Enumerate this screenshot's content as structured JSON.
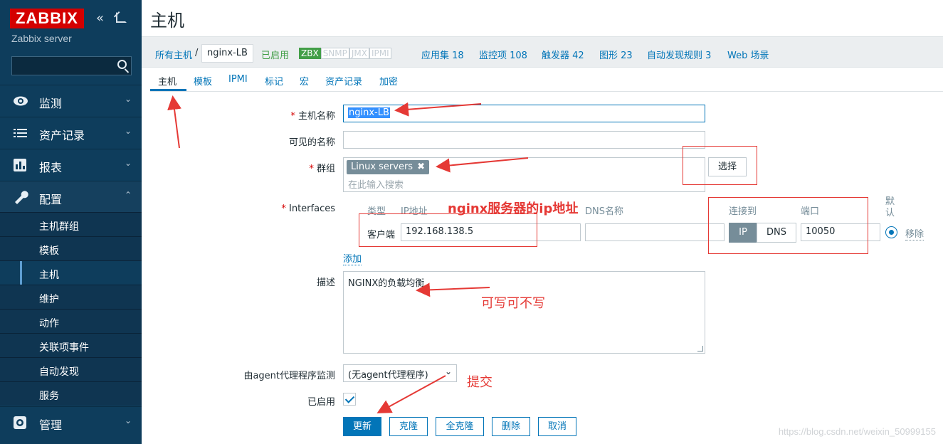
{
  "sidebar": {
    "logo": "ZABBIX",
    "server_name": "Zabbix server",
    "collapse_icon": "«",
    "menu": [
      {
        "label": "监测",
        "icon": "eye-icon"
      },
      {
        "label": "资产记录",
        "icon": "list-icon"
      },
      {
        "label": "报表",
        "icon": "bar-chart-icon"
      },
      {
        "label": "配置",
        "icon": "wrench-icon"
      },
      {
        "label": "管理",
        "icon": "gear-icon"
      }
    ],
    "submenu": [
      "主机群组",
      "模板",
      "主机",
      "维护",
      "动作",
      "关联项事件",
      "自动发现",
      "服务"
    ],
    "active_submenu": "主机"
  },
  "page": {
    "title": "主机"
  },
  "host_nav": {
    "all_hosts": "所有主机",
    "separator": "/",
    "current_host": "nginx-LB",
    "enabled": "已启用",
    "badges": [
      {
        "label": "ZBX",
        "active": true
      },
      {
        "label": "SNMP",
        "active": false
      },
      {
        "label": "JMX",
        "active": false
      },
      {
        "label": "IPMI",
        "active": false
      }
    ],
    "links": {
      "applications": "应用集 18",
      "items": "监控项 108",
      "triggers": "触发器 42",
      "graphs": "图形 23",
      "discovery": "自动发现规则 3",
      "web": "Web 场景"
    }
  },
  "tabs": [
    "主机",
    "模板",
    "IPMI",
    "标记",
    "宏",
    "资产记录",
    "加密"
  ],
  "form": {
    "host_name_label": "主机名称",
    "host_name_value": "nginx-LB",
    "visible_name_label": "可见的名称",
    "visible_name_value": "",
    "groups_label": "群组",
    "group_tag": "Linux servers",
    "group_placeholder": "在此输入搜索",
    "select_button": "选择",
    "interfaces_label": "Interfaces",
    "col_type": "类型",
    "col_ip": "IP地址",
    "col_dns": "DNS名称",
    "col_connect": "连接到",
    "col_port": "端口",
    "col_default": "默认",
    "iface_type": "客户端",
    "iface_ip": "192.168.138.5",
    "iface_dns": "",
    "connect_ip": "IP",
    "connect_dns": "DNS",
    "iface_port": "10050",
    "remove_link": "移除",
    "add_link": "添加",
    "description_label": "描述",
    "description_value": "NGINX的负载均衡",
    "proxy_label": "由agent代理程序监测",
    "proxy_value": "(无agent代理程序)",
    "enabled_label": "已启用",
    "buttons": {
      "update": "更新",
      "clone": "克隆",
      "full_clone": "全克隆",
      "delete": "删除",
      "cancel": "取消"
    }
  },
  "annotations": {
    "ip_note": "nginx服务器的ip地址",
    "desc_note": "可写可不写",
    "submit_note": "提交"
  },
  "watermark": "https://blog.csdn.net/weixin_50999155",
  "colors": {
    "sidebar": "#0e3d5c",
    "accent": "#0275b8",
    "logo": "#d40000",
    "annotation": "#e53935",
    "enabled": "#429e47"
  }
}
